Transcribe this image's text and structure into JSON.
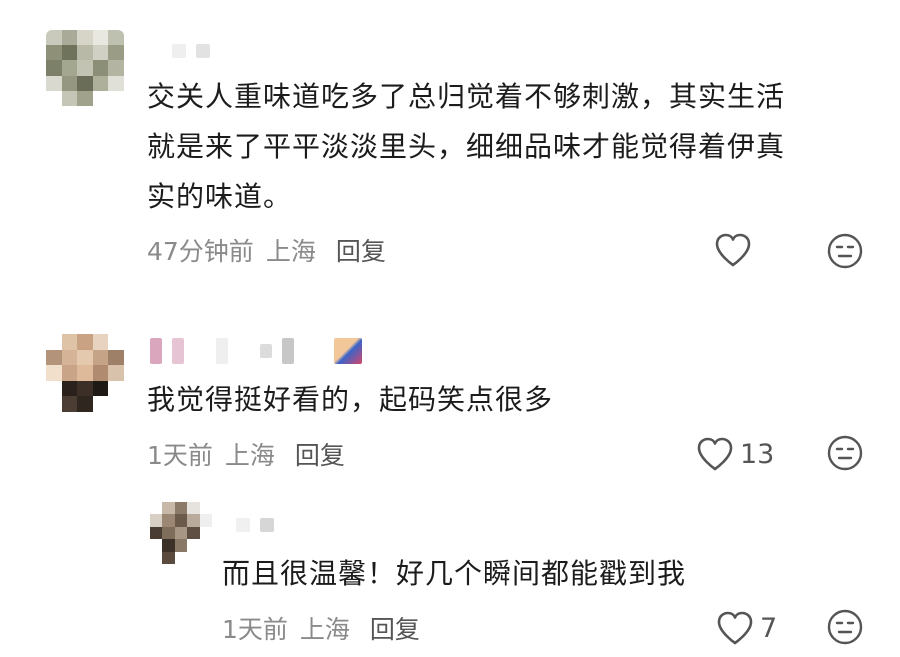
{
  "comments": [
    {
      "text": "交关人重味道吃多了总归觉着不够刺激，其实生活\n就是来了平平淡淡里头，细细品味才能觉得着伊真\n实的味道。",
      "time": "47分钟前",
      "location": "上海",
      "reply_label": "回复",
      "like_count": ""
    },
    {
      "text": "我觉得挺好看的，起码笑点很多",
      "time": "1天前",
      "location": "上海",
      "reply_label": "回复",
      "like_count": "13"
    }
  ],
  "reply": {
    "text": "而且很温馨！好几个瞬间都能戳到我",
    "time": "1天前",
    "location": "上海",
    "reply_label": "回复",
    "like_count": "7"
  },
  "icons": {
    "like": "heart-outline-icon",
    "dislike": "neutral-face-icon"
  }
}
